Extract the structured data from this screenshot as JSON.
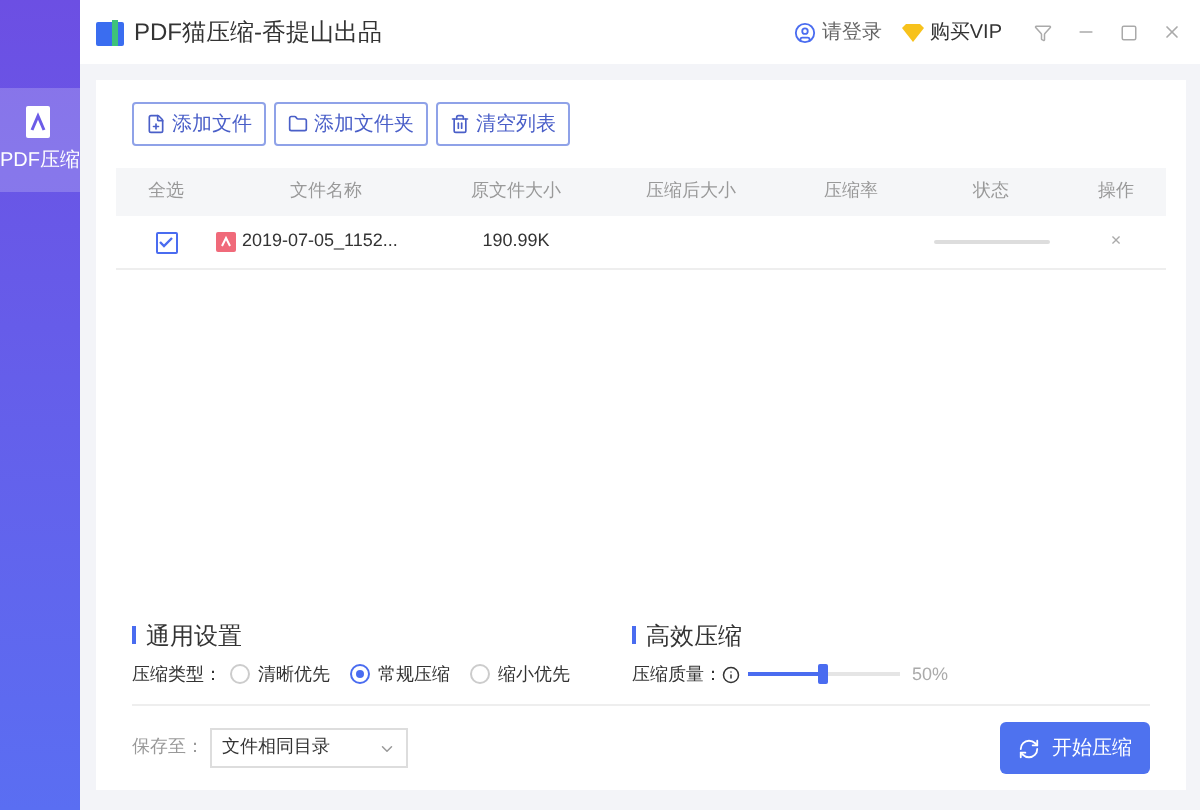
{
  "window": {
    "title": "PDF猫压缩-香提山出品"
  },
  "header": {
    "login": "请登录",
    "vip": "购买VIP"
  },
  "sidebar": {
    "items": [
      {
        "label": "PDF压缩",
        "selected": true
      }
    ]
  },
  "toolbar": [
    "添加文件",
    "添加文件夹",
    "清空列表"
  ],
  "table": {
    "columns": [
      "全选",
      "文件名称",
      "原文件大小",
      "压缩后大小",
      "压缩率",
      "状态",
      "操作"
    ],
    "rows": [
      {
        "checked": true,
        "name": "2019-07-05_1152...",
        "size": "190.99K",
        "progress": {
          "level": 0
        },
        "remove": "×"
      }
    ]
  },
  "general": {
    "title": "通用设置",
    "label": "压缩类型：",
    "options": [
      {
        "label": "清晰优先",
        "selected": false
      },
      {
        "label": "常规压缩",
        "selected": true
      },
      {
        "label": "缩小优先",
        "selected": false
      }
    ]
  },
  "efficient": {
    "title": "高效压缩",
    "label": "压缩质量：",
    "level": 0.5,
    "reading": "50%"
  },
  "save": {
    "label": "保存至：",
    "value": "文件相同目录"
  },
  "start_button": "开始压缩"
}
